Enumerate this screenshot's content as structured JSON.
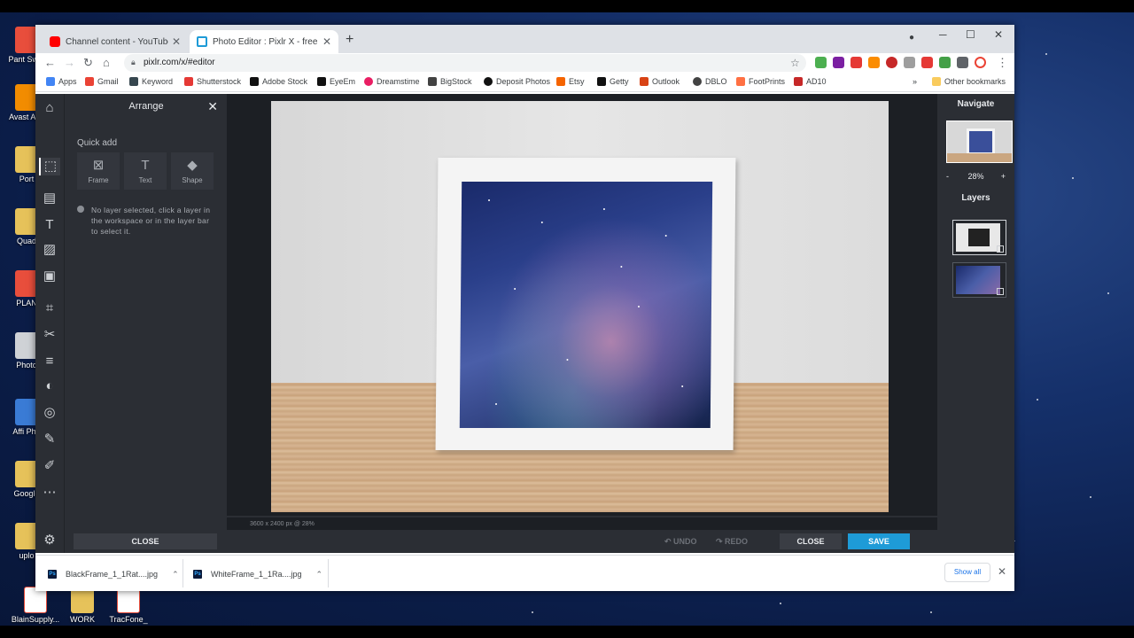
{
  "desktop": {
    "icons": [
      {
        "label": "Pant Swat"
      },
      {
        "label": "Avast Anti"
      },
      {
        "label": "Port"
      },
      {
        "label": "Quad"
      },
      {
        "label": "PLAN"
      },
      {
        "label": "Photo"
      },
      {
        "label": "Affi Pho"
      },
      {
        "label": "Google"
      },
      {
        "label": "uplo"
      },
      {
        "label": "BlainSupply..."
      },
      {
        "label": "WORK"
      },
      {
        "label": "TracFone_"
      }
    ]
  },
  "browser": {
    "tabs": [
      {
        "title": "Channel content - YouTube Studio",
        "active": false
      },
      {
        "title": "Photo Editor : Pixlr X - free image",
        "active": true
      }
    ],
    "new_tab": "+",
    "url": "pixlr.com/x/#editor",
    "bookmarks": [
      {
        "label": "Apps"
      },
      {
        "label": "Gmail"
      },
      {
        "label": "Keyword"
      },
      {
        "label": "Shutterstock"
      },
      {
        "label": "Adobe Stock"
      },
      {
        "label": "EyeEm"
      },
      {
        "label": "Dreamstime"
      },
      {
        "label": "BigStock"
      },
      {
        "label": "Deposit Photos"
      },
      {
        "label": "Etsy"
      },
      {
        "label": "Getty"
      },
      {
        "label": "Outlook"
      },
      {
        "label": "DBLO"
      },
      {
        "label": "FootPrints"
      },
      {
        "label": "AD10"
      }
    ],
    "more_bookmarks": "»",
    "other_bookmarks": "Other bookmarks"
  },
  "editor": {
    "panel_title": "Arrange",
    "quick_add_label": "Quick add",
    "quick_add": [
      {
        "label": "Frame",
        "icon": "frame-icon"
      },
      {
        "label": "Text",
        "icon": "text-icon"
      },
      {
        "label": "Shape",
        "icon": "shape-icon"
      }
    ],
    "hint": "No layer selected, click a layer in the workspace or in the layer bar to select it.",
    "panel_close": "CLOSE",
    "canvas_info": "3600 x 2400 px @ 28%",
    "undo": "UNDO",
    "redo": "REDO",
    "close": "CLOSE",
    "save": "SAVE",
    "navigate_title": "Navigate",
    "zoom_minus": "-",
    "zoom_value": "28%",
    "zoom_plus": "+",
    "layers_title": "Layers",
    "accent_color": "#1e9bd7"
  },
  "downloads": {
    "items": [
      {
        "name": "BlackFrame_1_1Rat....jpg"
      },
      {
        "name": "WhiteFrame_1_1Ra....jpg"
      }
    ],
    "show_all": "Show all"
  }
}
